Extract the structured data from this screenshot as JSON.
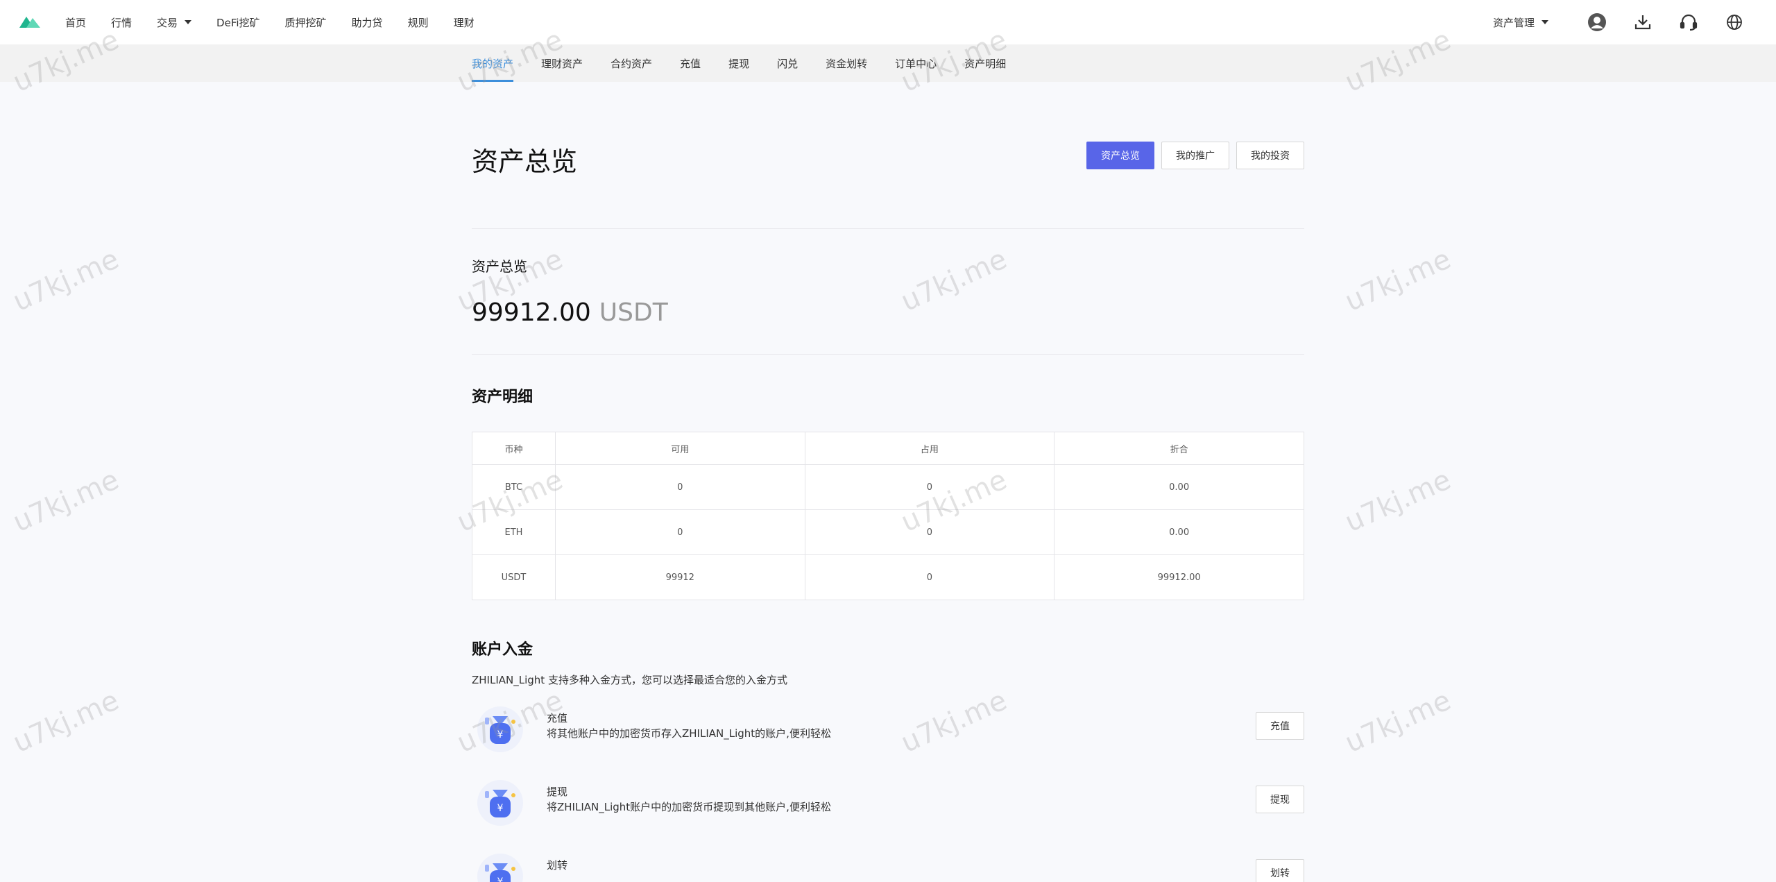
{
  "nav": {
    "items": [
      {
        "label": "首页"
      },
      {
        "label": "行情"
      },
      {
        "label": "交易",
        "dropdown": true
      },
      {
        "label": "DeFi挖矿"
      },
      {
        "label": "质押挖矿"
      },
      {
        "label": "助力贷"
      },
      {
        "label": "规则"
      },
      {
        "label": "理财"
      }
    ],
    "asset_mgmt": "资产管理",
    "icons": [
      "user-icon",
      "download-icon",
      "headset-icon",
      "globe-icon"
    ]
  },
  "subnav": {
    "items": [
      "我的资产",
      "理财资产",
      "合约资产",
      "充值",
      "提现",
      "闪兑",
      "资金划转",
      "订单中心",
      "资产明细"
    ],
    "active_index": 0
  },
  "page": {
    "title": "资产总览",
    "buttons": [
      "资产总览",
      "我的推广",
      "我的投资"
    ],
    "total_label": "资产总览",
    "total_value": "99912.00",
    "total_unit": "USDT"
  },
  "details": {
    "title": "资产明细",
    "headers": [
      "币种",
      "可用",
      "占用",
      "折合"
    ],
    "rows": [
      [
        "BTC",
        "0",
        "0",
        "0.00"
      ],
      [
        "ETH",
        "0",
        "0",
        "0.00"
      ],
      [
        "USDT",
        "99912",
        "0",
        "99912.00"
      ]
    ]
  },
  "deposit": {
    "title": "账户入金",
    "subtitle": "ZHILIAN_Light 支持多种入金方式，您可以选择最适合您的入金方式",
    "methods": [
      {
        "name": "充值",
        "desc": "将其他账户中的加密货币存入ZHILIAN_Light的账户,便利轻松",
        "button": "充值"
      },
      {
        "name": "提现",
        "desc": "将ZHILIAN_Light账户中的加密货币提现到其他账户,便利轻松",
        "button": "提现"
      },
      {
        "name": "划转",
        "desc": "",
        "button": "划转"
      }
    ]
  },
  "watermark": "u7kj.me",
  "colors": {
    "accent": "#3d8fdb",
    "primary_button": "#5865e8",
    "logo": "#3cc8a0"
  }
}
